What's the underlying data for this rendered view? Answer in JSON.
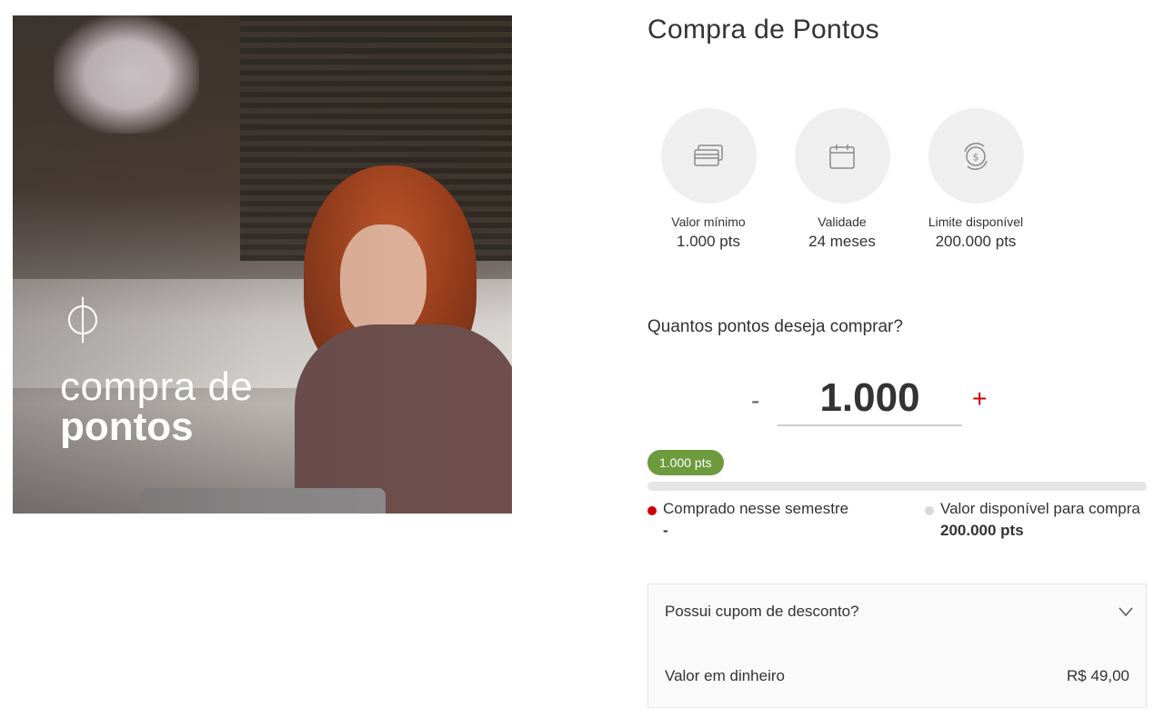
{
  "hero": {
    "brand_symbol": "⏀",
    "title_light": "compra de",
    "title_bold": "pontos"
  },
  "page_title": "Compra de Pontos",
  "info_cards": [
    {
      "icon": "credit-card-icon",
      "label": "Valor mínimo",
      "value": "1.000 pts"
    },
    {
      "icon": "calendar-icon",
      "label": "Validade",
      "value": "24 meses"
    },
    {
      "icon": "cycle-money-icon",
      "label": "Limite disponível",
      "value": "200.000 pts"
    }
  ],
  "purchase": {
    "question": "Quantos pontos deseja comprar?",
    "minus_label": "-",
    "plus_label": "+",
    "quantity": "1.000",
    "selected_badge": "1.000 pts",
    "progress_fraction": 0.0
  },
  "legend": {
    "purchased": {
      "label": "Comprado nesse semestre",
      "value": "-",
      "color": "#cc0000"
    },
    "available": {
      "label": "Valor disponível para compra",
      "value": "200.000 pts",
      "color": "#d9d9d9"
    }
  },
  "coupon": {
    "label": "Possui cupom de desconto?"
  },
  "cash": {
    "label": "Valor em dinheiro",
    "value": "R$ 49,00"
  },
  "colors": {
    "accent_red": "#cc0000",
    "badge_green": "#6d9a3d",
    "circle_bg": "#efefef"
  }
}
